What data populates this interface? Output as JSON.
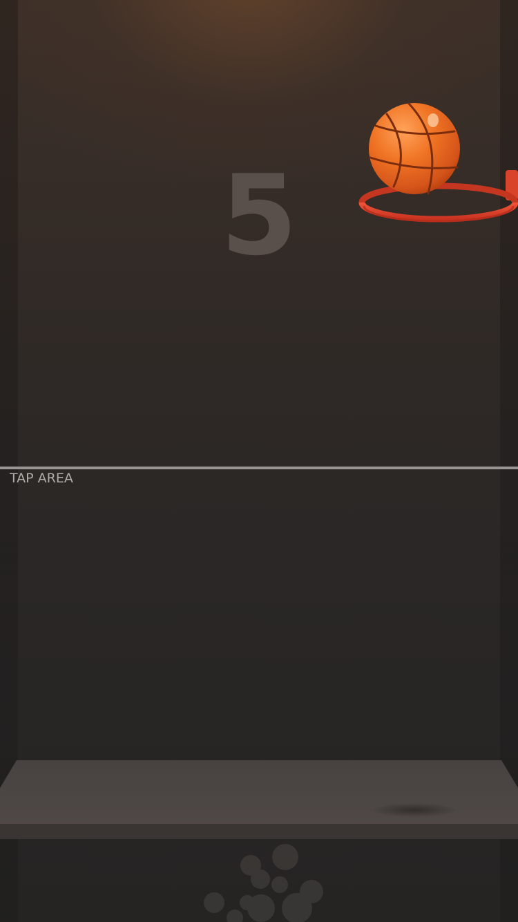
{
  "game": {
    "score": "5",
    "tap_area_label": "TAP AREA"
  },
  "colors": {
    "ball": "#e8641c",
    "rim": "#e5462a",
    "score": "#5a504b",
    "divider": "#9a9593"
  },
  "icons": {
    "ball": "basketball-icon",
    "hoop": "hoop-rim-icon"
  }
}
